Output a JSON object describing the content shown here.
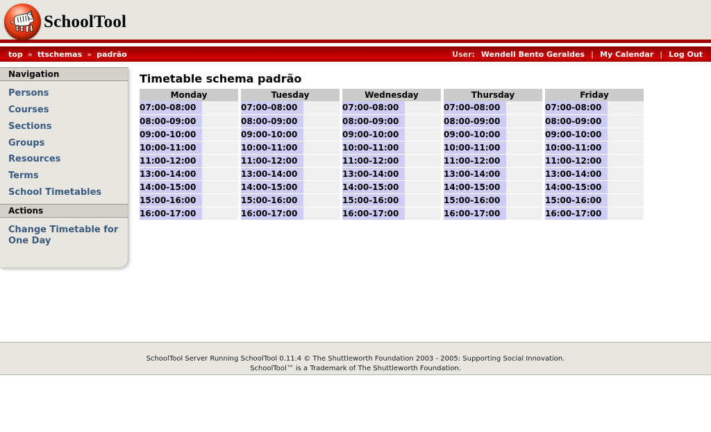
{
  "app": {
    "name": "SchoolTool",
    "logo_icon": "zebra-ball-logo"
  },
  "breadcrumb": {
    "items": [
      "top",
      "ttschemas",
      "padrão"
    ],
    "separator": "»"
  },
  "userbar": {
    "user_label": "User:",
    "user_name": "Wendell Bento Geraldes",
    "separator": "|",
    "my_calendar": "My Calendar",
    "log_out": "Log Out"
  },
  "sidebar": {
    "navigation_heading": "Navigation",
    "navigation_items": [
      "Persons",
      "Courses",
      "Sections",
      "Groups",
      "Resources",
      "Terms",
      "School Timetables"
    ],
    "actions_heading": "Actions",
    "actions_items": [
      "Change Timetable for One Day"
    ]
  },
  "main": {
    "title": "Timetable schema padrão",
    "days": [
      "Monday",
      "Tuesday",
      "Wednesday",
      "Thursday",
      "Friday"
    ],
    "periods": [
      "07:00-08:00",
      "08:00-09:00",
      "09:00-10:00",
      "10:00-11:00",
      "11:00-12:00",
      "13:00-14:00",
      "14:00-15:00",
      "15:00-16:00",
      "16:00-17:00"
    ],
    "activities": [
      [
        "",
        "",
        "",
        "",
        ""
      ],
      [
        "",
        "",
        "",
        "",
        ""
      ],
      [
        "",
        "",
        "",
        "",
        ""
      ],
      [
        "",
        "",
        "",
        "",
        ""
      ],
      [
        "",
        "",
        "",
        "",
        ""
      ],
      [
        "",
        "",
        "",
        "",
        ""
      ],
      [
        "",
        "",
        "",
        "",
        ""
      ],
      [
        "",
        "",
        "",
        "",
        ""
      ],
      [
        "",
        "",
        "",
        "",
        ""
      ]
    ]
  },
  "footer": {
    "line1": "SchoolTool Server Running SchoolTool 0.11.4 © The Shuttleworth Foundation 2003 - 2005: Supporting Social Innovation.",
    "line2": "SchoolTool™ is a Trademark of The Shuttleworth Foundation."
  },
  "colors": {
    "brand_red": "#a40000",
    "nav_red": "#b50000",
    "panel_beige": "#e8e6e0",
    "period_lavender": "#ccccf5",
    "activity_gray": "#efefef",
    "dayhead_gray": "#cbcbcb",
    "link_blue": "#3b5a80"
  }
}
